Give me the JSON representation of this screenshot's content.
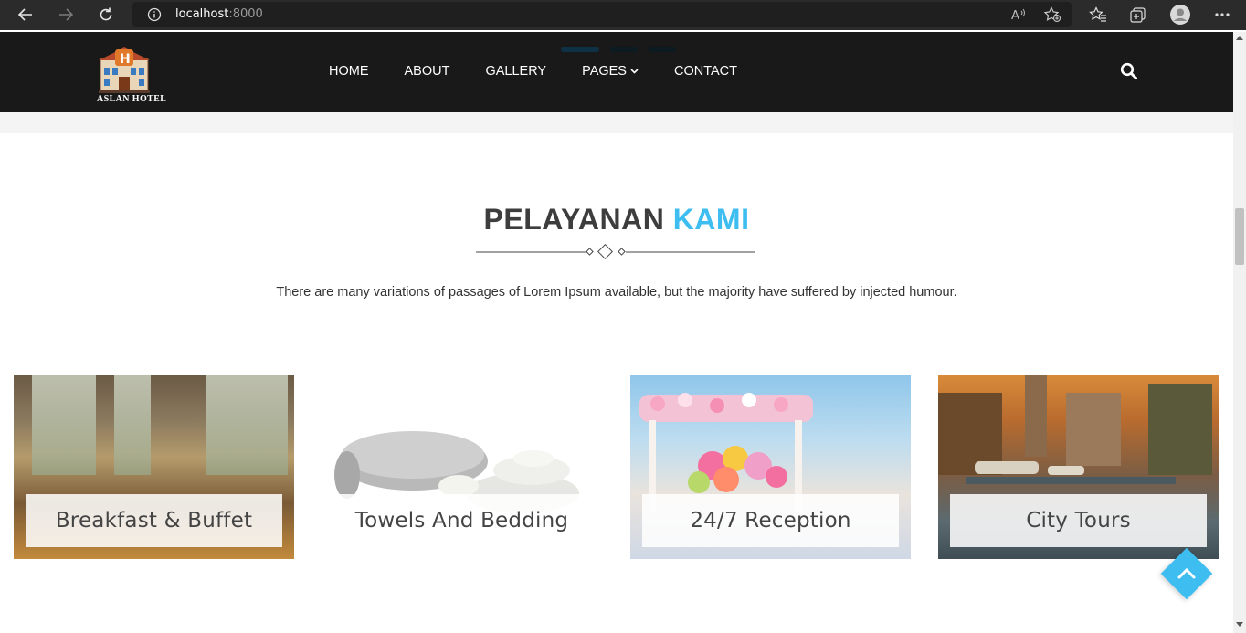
{
  "browser": {
    "url_host": "localhost",
    "url_port": ":8000",
    "icons": [
      "back-icon",
      "forward-icon",
      "refresh-icon",
      "info-icon",
      "read-aloud-icon",
      "add-favorite-icon",
      "favorites-icon",
      "collections-icon",
      "profile-icon",
      "more-icon"
    ]
  },
  "header": {
    "logo_text": "ASLAN HOTEL",
    "nav": [
      {
        "label": "HOME"
      },
      {
        "label": "ABOUT"
      },
      {
        "label": "GALLERY"
      },
      {
        "label": "PAGES",
        "has_dropdown": true
      },
      {
        "label": "CONTACT"
      }
    ],
    "search_icon": "search-icon"
  },
  "section": {
    "title_main": "PELAYANAN",
    "title_accent": "KAMI",
    "description": "There are many variations of passages of Lorem Ipsum available, but the majority have suffered by injected humour."
  },
  "services": [
    {
      "label": "Breakfast & Buffet"
    },
    {
      "label": "Towels And Bedding"
    },
    {
      "label": "24/7 Reception"
    },
    {
      "label": "City Tours"
    }
  ],
  "colors": {
    "accent": "#3ebdf0",
    "header_bg": "#191919",
    "title": "#3d3d3d"
  }
}
